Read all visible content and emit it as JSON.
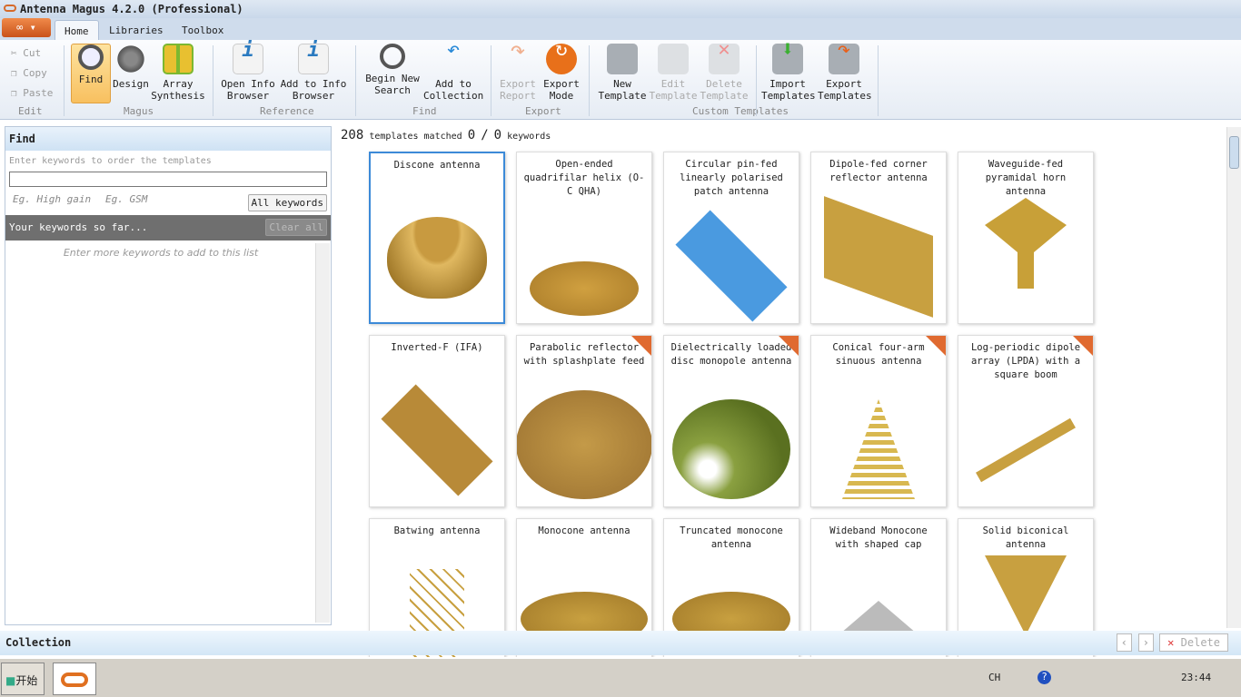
{
  "window": {
    "title": "Antenna Magus 4.2.0 (Professional)"
  },
  "tabs": [
    "Home",
    "Libraries",
    "Toolbox"
  ],
  "ribbon": {
    "edit": {
      "cut": "Cut",
      "copy": "Copy",
      "paste": "Paste",
      "group": "Edit"
    },
    "magus": {
      "find": "Find",
      "design": "Design",
      "array": "Array\nSynthesis",
      "group": "Magus"
    },
    "reference": {
      "open": "Open Info\nBrowser",
      "add": "Add to Info\nBrowser",
      "group": "Reference"
    },
    "find": {
      "begin": "Begin New\nSearch",
      "add": "Add to\nCollection",
      "group": "Find"
    },
    "export": {
      "report": "Export\nReport",
      "mode": "Export\nMode",
      "group": "Export"
    },
    "custom": {
      "new": "New\nTemplate",
      "edit": "Edit\nTemplate",
      "delete": "Delete\nTemplate",
      "import": "Import\nTemplates",
      "export": "Export\nTemplates",
      "group": "Custom Templates"
    }
  },
  "find_panel": {
    "title": "Find",
    "hint": "Enter keywords to order the templates",
    "input": "",
    "eg1": "Eg. High gain",
    "eg2": "Eg. GSM",
    "all_keywords": "All keywords",
    "keywords_bar": "Your keywords so far...",
    "clear_all": "Clear all",
    "empty": "Enter more keywords to add to this list"
  },
  "results": {
    "count": "208",
    "count_label": "templates matched",
    "kw_done": "0",
    "kw_sep": "/",
    "kw_total": "0",
    "kw_label": "keywords"
  },
  "cards": [
    {
      "title": "Discone antenna",
      "custom": false
    },
    {
      "title": "Open-ended quadrifilar helix (O-C QHA)",
      "custom": false
    },
    {
      "title": "Circular pin-fed linearly polarised patch antenna",
      "custom": false
    },
    {
      "title": "Dipole-fed corner reflector antenna",
      "custom": false
    },
    {
      "title": "Waveguide-fed pyramidal horn antenna",
      "custom": false
    },
    {
      "title": "Inverted-F (IFA)",
      "custom": false
    },
    {
      "title": "Parabolic reflector with splashplate feed",
      "custom": true
    },
    {
      "title": "Dielectrically loaded disc monopole antenna",
      "custom": true
    },
    {
      "title": "Conical four-arm sinuous antenna",
      "custom": true
    },
    {
      "title": "Log-periodic dipole array (LPDA) with a square boom",
      "custom": true
    },
    {
      "title": "Batwing antenna",
      "custom": false
    },
    {
      "title": "Monocone antenna",
      "custom": false
    },
    {
      "title": "Truncated monocone antenna",
      "custom": false
    },
    {
      "title": "Wideband Monocone with shaped cap",
      "custom": false
    },
    {
      "title": "Solid biconical antenna",
      "custom": false
    }
  ],
  "collection": {
    "title": "Collection",
    "delete": "Delete"
  },
  "taskbar": {
    "start": "开始",
    "lang": "CH",
    "time": "23:44"
  },
  "colors": {
    "accent": "#3c8ad8",
    "gold": "#c8a040",
    "custom_corner": "#e06a30"
  }
}
